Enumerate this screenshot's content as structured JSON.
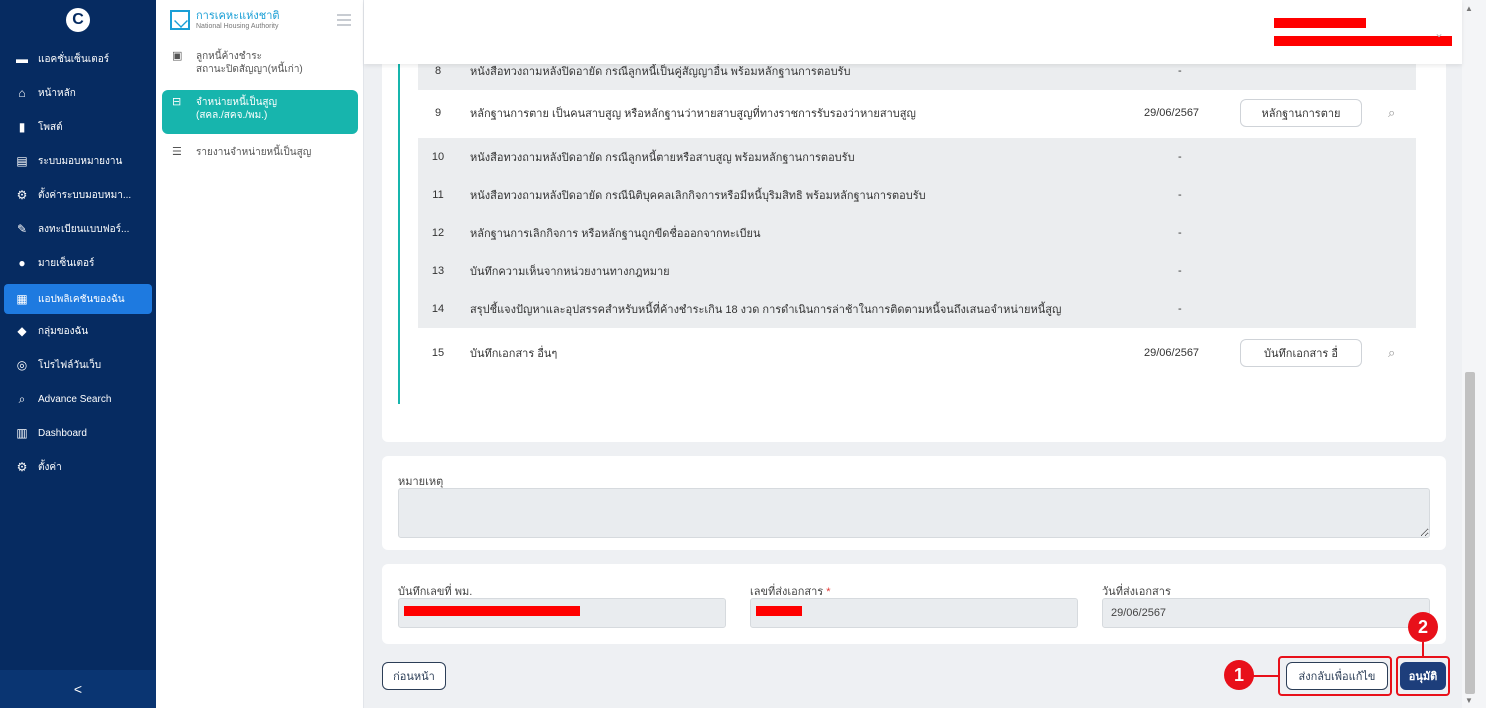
{
  "sidebar": {
    "logo": "C",
    "items": [
      {
        "label": "แอคชั่นเซ็นเตอร์",
        "icon": "inbox-icon",
        "glyph": "▬"
      },
      {
        "label": "หน้าหลัก",
        "icon": "home-icon",
        "glyph": "⌂"
      },
      {
        "label": "โพสต์",
        "icon": "post-icon",
        "glyph": "▮"
      },
      {
        "label": "ระบบมอบหมายงาน",
        "icon": "document-icon",
        "glyph": "▤"
      },
      {
        "label": "ตั้งค่าระบบมอบหมา...",
        "icon": "gear-icon",
        "glyph": "⚙"
      },
      {
        "label": "ลงทะเบียนแบบฟอร์...",
        "icon": "form-edit-icon",
        "glyph": "✎"
      },
      {
        "label": "มายเซ็นเตอร์",
        "icon": "user-icon",
        "glyph": "●"
      },
      {
        "label": "แอปพลิเคชันของฉัน",
        "icon": "apps-icon",
        "glyph": "▦"
      },
      {
        "label": "กลุ่มของฉัน",
        "icon": "group-icon",
        "glyph": "◆"
      },
      {
        "label": "โปรไฟล์วันเว็บ",
        "icon": "profile-icon",
        "glyph": "◎"
      },
      {
        "label": "Advance Search",
        "icon": "search-icon",
        "glyph": "⌕"
      },
      {
        "label": "Dashboard",
        "icon": "chart-icon",
        "glyph": "▥"
      },
      {
        "label": "ตั้งค่า",
        "icon": "settings-icon",
        "glyph": "⚙"
      }
    ],
    "collapse": "<"
  },
  "subpanel": {
    "org_name_th": "การเคหะแห่งชาติ",
    "org_name_en": "National Housing Authority",
    "items": [
      {
        "label": "ลูกหนี้ค้างชำระ\nสถานะปิดสัญญา(หนี้เก่า)",
        "glyph": "▣"
      },
      {
        "label": "จำหน่ายหนี้เป็นสูญ\n(สคล./สคจ./พม.)",
        "glyph": "⊟"
      },
      {
        "label": "รายงานจำหน่ายหนี้เป็นสูญ",
        "glyph": "☰"
      }
    ]
  },
  "documents": [
    {
      "num": "8",
      "desc": "หนังสือทวงถามหลังปิดอายัด กรณีลูกหนี้เป็นคู่สัญญาอื่น พร้อมหลักฐานการตอบรับ",
      "date": "",
      "value": "-",
      "button": ""
    },
    {
      "num": "9",
      "desc": "หลักฐานการตาย เป็นคนสาบสูญ หรือหลักฐานว่าหายสาบสูญที่ทางราชการรับรองว่าหายสาบสูญ",
      "date": "29/06/2567",
      "value": "",
      "button": "หลักฐานการตาย"
    },
    {
      "num": "10",
      "desc": "หนังสือทวงถามหลังปิดอายัด กรณีลูกหนี้ตายหรือสาบสูญ พร้อมหลักฐานการตอบรับ",
      "date": "",
      "value": "-",
      "button": ""
    },
    {
      "num": "11",
      "desc": "หนังสือทวงถามหลังปิดอายัด กรณีนิติบุคคลเลิกกิจการหรือมีหนี้บุริมสิทธิ พร้อมหลักฐานการตอบรับ",
      "date": "",
      "value": "-",
      "button": ""
    },
    {
      "num": "12",
      "desc": "หลักฐานการเลิกกิจการ หรือหลักฐานถูกขีดชื่อออกจากทะเบียน",
      "date": "",
      "value": "-",
      "button": ""
    },
    {
      "num": "13",
      "desc": "บันทึกความเห็นจากหน่วยงานทางกฎหมาย",
      "date": "",
      "value": "-",
      "button": ""
    },
    {
      "num": "14",
      "desc": "สรุปชี้แจงปัญหาและอุปสรรคสำหรับหนี้ที่ค้างชำระเกิน 18 งวด การดำเนินการล่าช้าในการติดตามหนี้จนถึงเสนอจำหน่ายหนี้สูญ",
      "date": "",
      "value": "-",
      "button": ""
    },
    {
      "num": "15",
      "desc": "บันทึกเอกสาร อื่นๆ",
      "date": "29/06/2567",
      "value": "",
      "button": "บันทึกเอกสาร อื่"
    }
  ],
  "remark": {
    "label": "หมายเหตุ",
    "value": ""
  },
  "fields": {
    "memo_no_label": "บันทึกเลขที่ พม.",
    "send_no_label": "เลขที่ส่งเอกสาร",
    "required_mark": "*",
    "send_date_label": "วันที่ส่งเอกสาร",
    "send_date_value": "29/06/2567"
  },
  "buttons": {
    "back": "ก่อนหน้า",
    "return_for_edit": "ส่งกลับเพื่อแก้ไข",
    "approve": "อนุมัติ"
  },
  "callouts": {
    "one": "1",
    "two": "2"
  },
  "colors": {
    "sidebar_bg": "#062b61",
    "active_blue": "#1e7ae0",
    "teal": "#17b5ad",
    "approve_bg": "#1d3e7b",
    "highlight_red": "#e8101a"
  }
}
